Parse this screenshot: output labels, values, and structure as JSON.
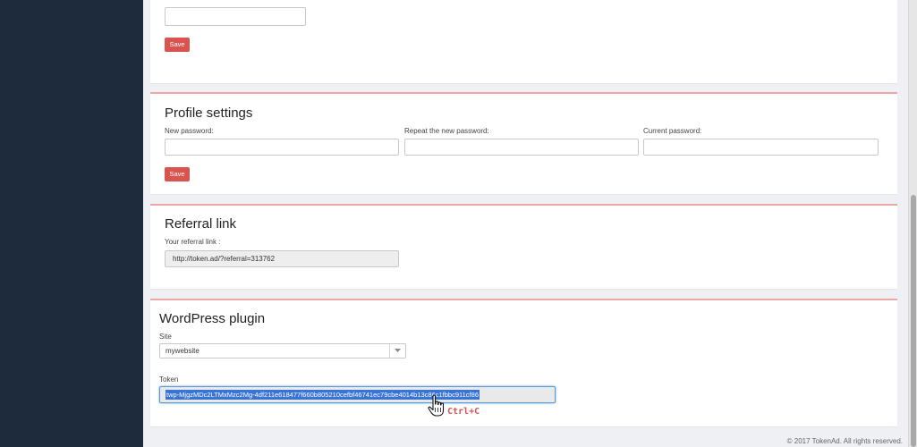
{
  "top_section": {
    "save_label": "Save"
  },
  "profile": {
    "title": "Profile settings",
    "new_password_label": "New password:",
    "repeat_password_label": "Repeat the new password:",
    "current_password_label": "Current password:",
    "save_label": "Save"
  },
  "referral": {
    "title": "Referral link",
    "label": "Your referral link :",
    "value": "http://token.ad/?referral=313762"
  },
  "wordpress": {
    "title": "WordPress plugin",
    "site_label": "Site",
    "site_value": "mywebsite",
    "token_label": "Token",
    "token_value": "twp-MjgzMDc2LTMxMzc2Mg-4df211e618477f660b805210cefbf46741ec79cbe4014b13c86c1fbbc911cf86"
  },
  "annotation": {
    "shortcut": "Ctrl+C"
  },
  "footer": {
    "copyright": "© 2017 TokenAd. All rights reserved."
  },
  "colors": {
    "sidebar": "#1e2b3c",
    "accent": "#d9534f",
    "section_border": "#eea7a7",
    "selection": "#3874d8"
  }
}
